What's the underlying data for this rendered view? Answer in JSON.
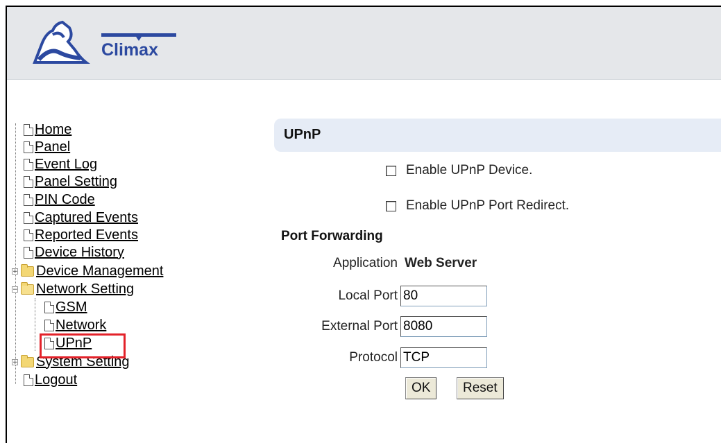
{
  "header": {
    "logo_text": "Climax"
  },
  "nav": {
    "items": [
      {
        "label": "Home"
      },
      {
        "label": "Panel"
      },
      {
        "label": "Event Log"
      },
      {
        "label": "Panel Setting"
      },
      {
        "label": "PIN Code"
      },
      {
        "label": "Captured Events"
      },
      {
        "label": "Reported Events"
      },
      {
        "label": "Device History"
      },
      {
        "label": "Device Management",
        "expander": "+"
      },
      {
        "label": "Network Setting",
        "expander": "−"
      },
      {
        "label": "GSM"
      },
      {
        "label": "Network"
      },
      {
        "label": "UPnP"
      },
      {
        "label": "System Setting",
        "expander": "+"
      },
      {
        "label": "Logout"
      }
    ]
  },
  "content": {
    "title": "UPnP",
    "enable_device_label": "Enable UPnP Device.",
    "enable_redirect_label": "Enable UPnP Port Redirect.",
    "section_title": "Port Forwarding",
    "application_label": "Application",
    "application_value": "Web Server",
    "local_port_label": "Local Port",
    "local_port_value": "80",
    "external_port_label": "External Port",
    "external_port_value": "8080",
    "protocol_label": "Protocol",
    "protocol_value": "TCP",
    "ok_label": "OK",
    "reset_label": "Reset"
  },
  "colors": {
    "highlight": "#e3222a",
    "title_bar": "#e6ecf6",
    "logo": "#2c49a0"
  }
}
